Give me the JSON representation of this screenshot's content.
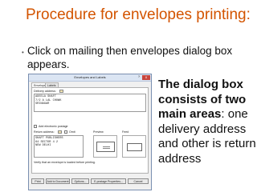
{
  "slide": {
    "title": "Procedure for envelopes printing:",
    "bullet": "Click on mailing then envelopes dialog box appears.",
    "callout_bold": "The dialog box consists of two main areas",
    "callout_rest": ": one delivery address and other is return address"
  },
  "dialog": {
    "title": "Envelopes and Labels",
    "help_glyph": "?",
    "close_glyph": "x",
    "tabs": [
      {
        "label": "Envelopes",
        "active": true
      },
      {
        "label": "Labels",
        "active": false
      }
    ],
    "delivery_label": "Delivery address:",
    "delivery_lines": [
      "ADEELA SHAFT",
      "7/2 A  LAL CHOWK",
      "SRINAGAR"
    ],
    "add_postage_label": "Add electronic postage",
    "return_label": "Return address:",
    "omit_label": "Omit",
    "return_lines": [
      "SHAFT PUBLISHERS",
      "64 SECTOR 4 2",
      "NEW DELHI"
    ],
    "preview_label": "Preview",
    "feed_label": "Feed",
    "verify_text": "Verify that an envelope is loaded before printing.",
    "buttons": [
      "Print",
      "Add to Document",
      "Options...",
      "E-postage Properties...",
      "Cancel"
    ]
  }
}
